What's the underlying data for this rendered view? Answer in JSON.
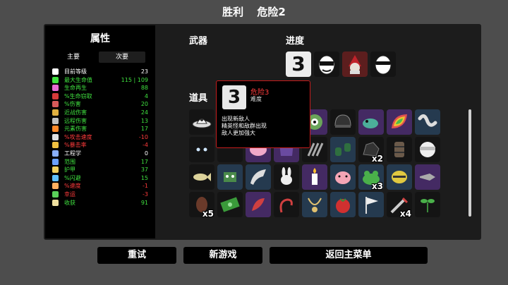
{
  "header": {
    "result": "胜利",
    "danger": "危险2"
  },
  "stats": {
    "title": "属性",
    "tabs": {
      "main": "主要",
      "secondary": "次要"
    },
    "rows": [
      {
        "name": "目前等级",
        "value": "23",
        "tone": "white",
        "icon_color": "#ffffff",
        "icon": "level-icon"
      },
      {
        "name": "最大生命值",
        "value": "115 | 109",
        "tone": "green",
        "icon_color": "#3fe03f",
        "icon": "heart-icon"
      },
      {
        "name": "生命再生",
        "value": "88",
        "tone": "green",
        "icon_color": "#e86bd4",
        "icon": "regen-icon"
      },
      {
        "name": "%生命窃取",
        "value": "4",
        "tone": "green",
        "icon_color": "#d63a3a",
        "icon": "lifesteal-icon"
      },
      {
        "name": "%伤害",
        "value": "20",
        "tone": "green",
        "icon_color": "#d65a5a",
        "icon": "damage-icon"
      },
      {
        "name": "近战伤害",
        "value": "24",
        "tone": "green",
        "icon_color": "#e0b040",
        "icon": "melee-icon"
      },
      {
        "name": "远程伤害",
        "value": "13",
        "tone": "green",
        "icon_color": "#c0c0c0",
        "icon": "ranged-icon"
      },
      {
        "name": "元素伤害",
        "value": "17",
        "tone": "green",
        "icon_color": "#ff8a2a",
        "icon": "elemental-icon"
      },
      {
        "name": "%攻击速度",
        "value": "-10",
        "tone": "red",
        "icon_color": "#e0e0e0",
        "icon": "attack-speed-icon"
      },
      {
        "name": "%暴击率",
        "value": "-4",
        "tone": "red",
        "icon_color": "#f0c040",
        "icon": "crit-icon"
      },
      {
        "name": "工程学",
        "value": "0",
        "tone": "white",
        "icon_color": "#8ab0ff",
        "icon": "engineering-icon"
      },
      {
        "name": "范围",
        "value": "17",
        "tone": "green",
        "icon_color": "#6aa0ff",
        "icon": "range-icon"
      },
      {
        "name": "护甲",
        "value": "37",
        "tone": "green",
        "icon_color": "#f0d060",
        "icon": "armor-icon"
      },
      {
        "name": "%闪避",
        "value": "15",
        "tone": "green",
        "icon_color": "#60c0ff",
        "icon": "dodge-icon"
      },
      {
        "name": "%速度",
        "value": "-1",
        "tone": "red",
        "icon_color": "#ffb060",
        "icon": "speed-icon"
      },
      {
        "name": "幸运",
        "value": "-3",
        "tone": "red",
        "icon_color": "#5ad05a",
        "icon": "luck-icon"
      },
      {
        "name": "收获",
        "value": "91",
        "tone": "green",
        "icon_color": "#f0e0a0",
        "icon": "harvest-icon"
      }
    ]
  },
  "weapons": {
    "title": "武器"
  },
  "progress": {
    "title": "进度",
    "items": [
      {
        "icon": "danger-3-icon",
        "glyph": "3",
        "tier": "sel"
      },
      {
        "icon": "masked-egg-icon",
        "tier": "t1"
      },
      {
        "icon": "red-wizard-icon",
        "tier": "t4"
      },
      {
        "icon": "sunglasses-egg-icon",
        "tier": "t1"
      }
    ]
  },
  "items": {
    "title": "道具",
    "grid": [
      [
        {
          "icon": "ufo-icon",
          "tier": "t1"
        },
        {
          "icon": "hidden-slot-icon",
          "tier": "t1"
        },
        {
          "icon": "hidden-slot-icon",
          "tier": "t1"
        },
        {
          "icon": "hidden-slot-icon",
          "tier": "t1"
        },
        {
          "icon": "monster-eye-icon",
          "tier": "t3"
        },
        {
          "icon": "helmet-icon",
          "tier": "t1"
        },
        {
          "icon": "lizard-icon",
          "tier": "t3"
        },
        {
          "icon": "rainbow-leaf-icon",
          "tier": "t3"
        },
        {
          "icon": "worm-icon",
          "tier": "t2"
        },
        {
          "icon": "potion-icon",
          "tier": "t2"
        }
      ],
      [
        {
          "icon": "shadow-eyes-icon",
          "tier": "t1"
        },
        {
          "icon": "hidden-slot-icon",
          "tier": "t1"
        },
        {
          "icon": "brain-icon",
          "tier": "t3"
        },
        {
          "icon": "demon-icon",
          "tier": "t3"
        },
        {
          "icon": "claw-icon",
          "tier": "t1"
        },
        {
          "icon": "binoculars-icon",
          "tier": "t2"
        },
        {
          "icon": "rock-icon",
          "tier": "t1",
          "count": "x2"
        },
        {
          "icon": "barrel-icon",
          "tier": "t1"
        },
        {
          "icon": "bandage-icon",
          "tier": "t1"
        },
        {
          "icon": "hedgehog-icon",
          "tier": "t1"
        }
      ],
      [
        {
          "icon": "fish-icon",
          "tier": "t1"
        },
        {
          "icon": "robot-icon",
          "tier": "t2"
        },
        {
          "icon": "horn-icon",
          "tier": "t2"
        },
        {
          "icon": "bunny-icon",
          "tier": "t1"
        },
        {
          "icon": "candle-icon",
          "tier": "t3"
        },
        {
          "icon": "piggy-bank-icon",
          "tier": "t2"
        },
        {
          "icon": "frog-icon",
          "tier": "t2",
          "count": "x3"
        },
        {
          "icon": "lemon-icon",
          "tier": "t2"
        },
        {
          "icon": "drill-icon",
          "tier": "t3"
        },
        {
          "icon": "skull-mask-icon",
          "tier": "t1"
        }
      ],
      [
        {
          "icon": "leaf-bug-icon",
          "tier": "t1",
          "count": "x5"
        },
        {
          "icon": "cash-icon",
          "tier": "t1"
        },
        {
          "icon": "scroll-icon",
          "tier": "t3"
        },
        {
          "icon": "tail-icon",
          "tier": "t1"
        },
        {
          "icon": "necklace-icon",
          "tier": "t2"
        },
        {
          "icon": "tomato-icon",
          "tier": "t2"
        },
        {
          "icon": "flag-icon",
          "tier": "t2"
        },
        {
          "icon": "syringe-icon",
          "tier": "t1",
          "count": "x4"
        },
        {
          "icon": "sprout-icon",
          "tier": "t1"
        },
        {
          "icon": "banana-icon",
          "tier": "t2",
          "count": "x2"
        },
        {
          "icon": "shell-icon",
          "tier": "t1",
          "count": "x2"
        }
      ]
    ]
  },
  "tooltip": {
    "glyph": "3",
    "title": "危险3",
    "subtitle": "难度",
    "lines": [
      "出现新敌人",
      "精英怪和敌群出现",
      "敌人更加强大"
    ]
  },
  "buttons": {
    "retry": "重试",
    "new_game": "新游戏",
    "main_menu": "返回主菜单"
  }
}
